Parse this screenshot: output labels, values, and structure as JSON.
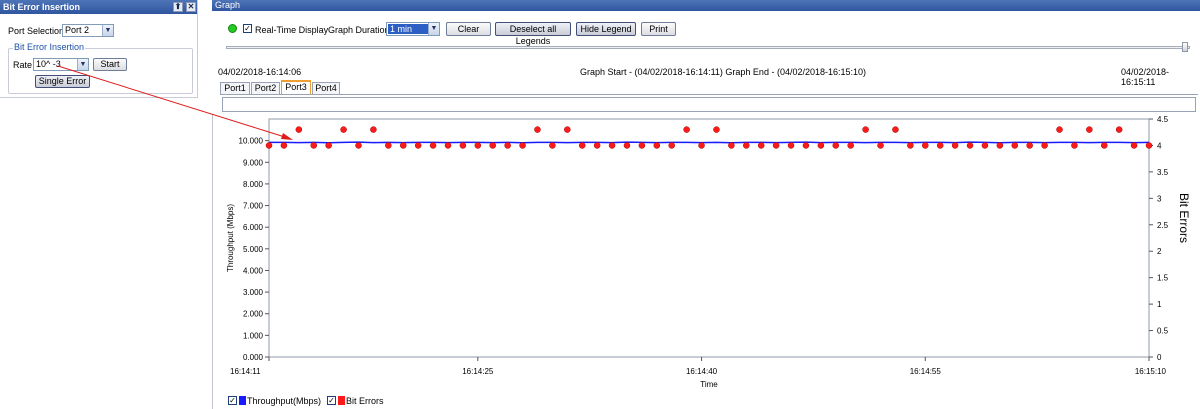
{
  "left_panel": {
    "title": "Bit Error Insertion",
    "pin_icon": "pin-icon",
    "close_icon": "close-icon",
    "port_selection_label": "Port Selection",
    "port_selection_value": "Port 2",
    "group_title": "Bit Error Insertion",
    "rate_label": "Rate",
    "rate_value": "10^ -3",
    "start_label": "Start",
    "single_error_label": "Single Error"
  },
  "graph_panel": {
    "title": "Graph",
    "realtime_label": "Real-Time Display",
    "realtime_checked": true,
    "duration_label": "Graph Duration",
    "duration_value": "1 min",
    "clear_label": "Clear",
    "deselect_label": "Deselect all Legends",
    "hide_legend_label": "Hide Legend",
    "print_label": "Print",
    "time_start": "04/02/2018-16:14:06",
    "time_range": "Graph Start - (04/02/2018-16:14:11) Graph End - (04/02/2018-16:15:10)",
    "time_end": "04/02/2018-16:15:11",
    "tabs": [
      {
        "label": "Port1",
        "active": false
      },
      {
        "label": "Port2",
        "active": false
      },
      {
        "label": "Port3",
        "active": true
      },
      {
        "label": "Port4",
        "active": false
      }
    ],
    "legend": [
      {
        "label": "Throughput(Mbps)",
        "color": "#1a1aff",
        "checked": true
      },
      {
        "label": "Bit Errors",
        "color": "#ff1a1a",
        "checked": true
      }
    ]
  },
  "chart_data": {
    "type": "line",
    "xlabel": "Time",
    "ylabel": "Throughput (Mbps)",
    "y2label": "Bit Errors",
    "xlim": [
      0,
      59
    ],
    "ylim": [
      0,
      11000
    ],
    "y2lim": [
      0,
      4.5
    ],
    "x_ticks": [
      {
        "value": 0,
        "label": "16:14:11"
      },
      {
        "value": 14,
        "label": "16:14:25"
      },
      {
        "value": 29,
        "label": "16:14:40"
      },
      {
        "value": 44,
        "label": "16:14:55"
      },
      {
        "value": 59,
        "label": "16:15:10"
      }
    ],
    "y_ticks": [
      {
        "value": 0,
        "label": "0.000"
      },
      {
        "value": 1000,
        "label": "1.000"
      },
      {
        "value": 2000,
        "label": "2.000"
      },
      {
        "value": 3000,
        "label": "3.000"
      },
      {
        "value": 4000,
        "label": "4.000"
      },
      {
        "value": 5000,
        "label": "5.000"
      },
      {
        "value": 6000,
        "label": "6.000"
      },
      {
        "value": 7000,
        "label": "7.000"
      },
      {
        "value": 8000,
        "label": "8.000"
      },
      {
        "value": 9000,
        "label": "9.000"
      },
      {
        "value": 10000,
        "label": "10.000"
      }
    ],
    "y2_ticks": [
      {
        "value": 0,
        "label": "0"
      },
      {
        "value": 0.5,
        "label": "0.5"
      },
      {
        "value": 1,
        "label": "1"
      },
      {
        "value": 1.5,
        "label": "1.5"
      },
      {
        "value": 2,
        "label": "2"
      },
      {
        "value": 2.5,
        "label": "2.5"
      },
      {
        "value": 3,
        "label": "3"
      },
      {
        "value": 3.5,
        "label": "3.5"
      },
      {
        "value": 4,
        "label": "4"
      },
      {
        "value": 4.5,
        "label": "4.5"
      }
    ],
    "series": [
      {
        "name": "Throughput(Mbps)",
        "axis": "left",
        "color": "#1a1aff",
        "x": [
          0,
          1,
          2,
          3,
          4,
          5,
          6,
          7,
          8,
          9,
          10,
          11,
          12,
          13,
          14,
          15,
          16,
          17,
          18,
          19,
          20,
          21,
          22,
          23,
          24,
          25,
          26,
          27,
          28,
          29,
          30,
          31,
          32,
          33,
          34,
          35,
          36,
          37,
          38,
          39,
          40,
          41,
          42,
          43,
          44,
          45,
          46,
          47,
          48,
          49,
          50,
          51,
          52,
          53,
          54,
          55,
          56,
          57,
          58,
          59
        ],
        "values": [
          9920,
          9920,
          9910,
          9920,
          9900,
          9920,
          9930,
          9910,
          9920,
          9910,
          9920,
          9920,
          9910,
          9920,
          9920,
          9910,
          9920,
          9900,
          9920,
          9920,
          9910,
          9920,
          9920,
          9910,
          9930,
          9920,
          9910,
          9920,
          9920,
          9910,
          9920,
          9900,
          9920,
          9920,
          9910,
          9920,
          9930,
          9910,
          9920,
          9920,
          9910,
          9920,
          9920,
          9910,
          9920,
          9920,
          9910,
          9930,
          9920,
          9900,
          9920,
          9920,
          9910,
          9920,
          9920,
          9910,
          9920,
          9920,
          9910,
          9920
        ]
      },
      {
        "name": "Bit Errors",
        "axis": "right",
        "color": "#ff1a1a",
        "x": [
          0,
          1,
          2,
          3,
          4,
          5,
          6,
          7,
          8,
          9,
          10,
          11,
          12,
          13,
          14,
          15,
          16,
          17,
          18,
          19,
          20,
          21,
          22,
          23,
          24,
          25,
          26,
          27,
          28,
          29,
          30,
          31,
          32,
          33,
          34,
          35,
          36,
          37,
          38,
          39,
          40,
          41,
          42,
          43,
          44,
          45,
          46,
          47,
          48,
          49,
          50,
          51,
          52,
          53,
          54,
          55,
          56,
          57,
          58,
          59
        ],
        "values": [
          4,
          4,
          4.3,
          4,
          4,
          4.3,
          4,
          4.3,
          4,
          4,
          4,
          4,
          4,
          4,
          4,
          4,
          4,
          4,
          4.3,
          4,
          4.3,
          4,
          4,
          4,
          4,
          4,
          4,
          4,
          4.3,
          4,
          4.3,
          4,
          4,
          4,
          4,
          4,
          4,
          4,
          4,
          4,
          4.3,
          4,
          4.3,
          4,
          4,
          4,
          4,
          4,
          4,
          4,
          4,
          4,
          4,
          4.3,
          4,
          4.3,
          4,
          4.3,
          4,
          4
        ]
      }
    ],
    "legend_position": "bottom-left"
  }
}
